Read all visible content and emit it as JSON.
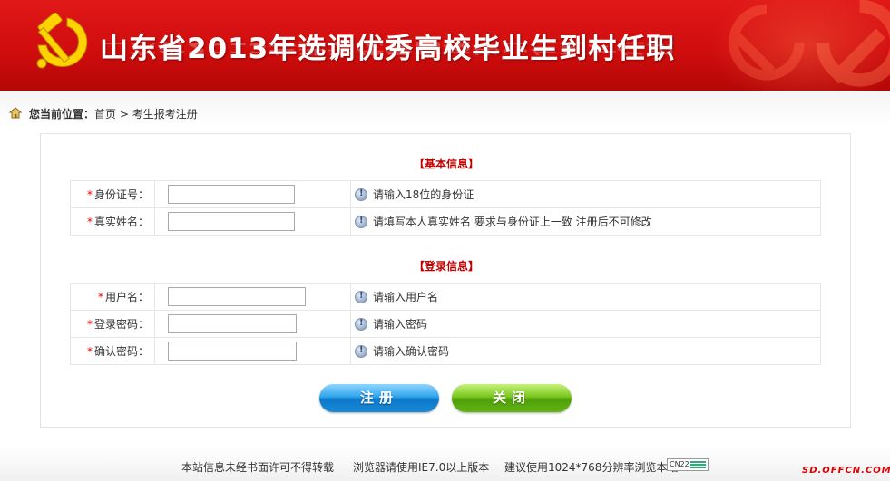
{
  "header": {
    "title": "山东省2013年选调优秀高校毕业生到村任职",
    "accent_color": "#d10d0d"
  },
  "breadcrumb": {
    "prefix": "您当前位置：",
    "path": "首页 > 考生报考注册",
    "icon": "home-icon"
  },
  "sections": {
    "basic": {
      "title": "【基本信息】",
      "fields": [
        {
          "label": "身份证号：",
          "value": "",
          "tip": "请输入18位的身份证"
        },
        {
          "label": "真实姓名：",
          "value": "",
          "tip": "请填写本人真实姓名 要求与身份证上一致 注册后不可修改"
        }
      ]
    },
    "login": {
      "title": "【登录信息】",
      "fields": [
        {
          "label": "用户名：",
          "value": "",
          "tip": "请输入用户名"
        },
        {
          "label": "登录密码：",
          "value": "",
          "tip": "请输入密码"
        },
        {
          "label": "确认密码：",
          "value": "",
          "tip": "请输入确认密码"
        }
      ]
    },
    "required_mark": "*"
  },
  "buttons": {
    "register": "注册",
    "close": "关闭"
  },
  "footer": {
    "notice": "本站信息未经书面许可不得转载",
    "browser": "浏览器请使用IE7.0以上版本",
    "resolution": "建议使用1024*768分辨率浏览本站",
    "counter_label": "CN22",
    "watermark": "SD.OFFCN.COM"
  }
}
